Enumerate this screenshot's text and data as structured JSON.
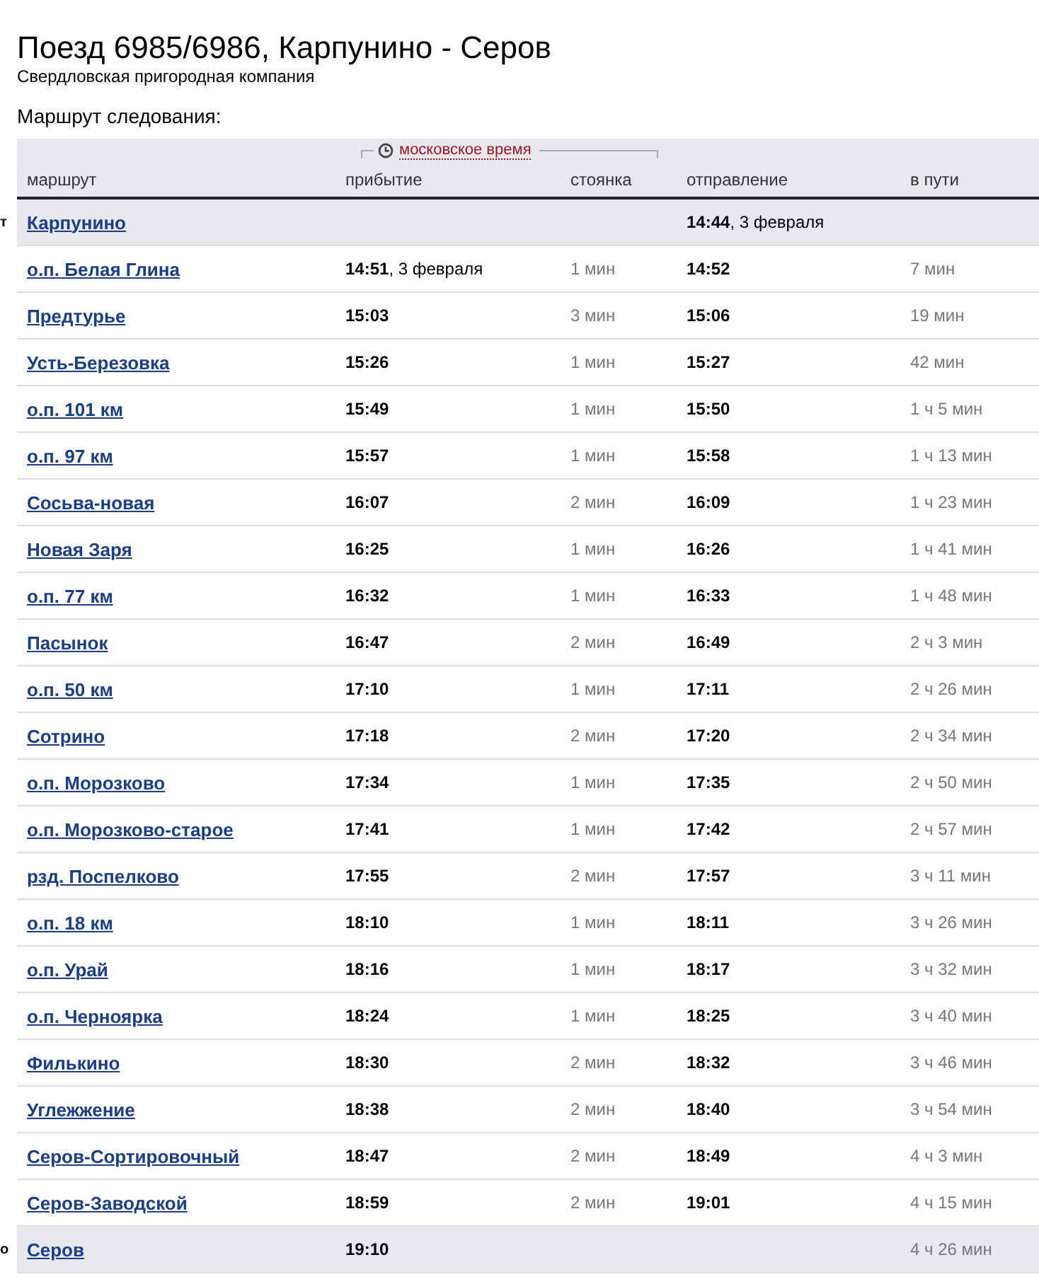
{
  "title": "Поезд 6985/6986, Карпунино - Серов",
  "subtitle": "Свердловская пригородная компания",
  "section_label": "Маршрут следования:",
  "time_zone_label": "московское время",
  "columns": [
    "маршрут",
    "прибытие",
    "стоянка",
    "отправление",
    "в пути"
  ],
  "rows": [
    {
      "kind": "terminal",
      "edge_mark": "т",
      "station": "Карпунино",
      "departure": "**14:44**, 3 февраля"
    },
    {
      "kind": "stop",
      "station": "о.п. Белая Глина",
      "arrival": "**14:51**, 3 февраля",
      "stop": "1 мин",
      "departure": "**14:52**",
      "travel": "7 мин"
    },
    {
      "kind": "stop",
      "station": "Предтурье",
      "arrival": "**15:03**",
      "stop": "3 мин",
      "departure": "**15:06**",
      "travel": "19 мин"
    },
    {
      "kind": "stop",
      "station": "Усть-Березовка",
      "arrival": "**15:26**",
      "stop": "1 мин",
      "departure": "**15:27**",
      "travel": "42 мин"
    },
    {
      "kind": "stop",
      "station": "о.п. 101 км",
      "arrival": "**15:49**",
      "stop": "1 мин",
      "departure": "**15:50**",
      "travel": "1 ч 5 мин"
    },
    {
      "kind": "stop",
      "station": "о.п. 97 км",
      "arrival": "**15:57**",
      "stop": "1 мин",
      "departure": "**15:58**",
      "travel": "1 ч 13 мин"
    },
    {
      "kind": "stop",
      "station": "Сосьва-новая",
      "arrival": "**16:07**",
      "stop": "2 мин",
      "departure": "**16:09**",
      "travel": "1 ч 23 мин"
    },
    {
      "kind": "stop",
      "station": "Новая Заря",
      "arrival": "**16:25**",
      "stop": "1 мин",
      "departure": "**16:26**",
      "travel": "1 ч 41 мин"
    },
    {
      "kind": "stop",
      "station": "о.п. 77 км",
      "arrival": "**16:32**",
      "stop": "1 мин",
      "departure": "**16:33**",
      "travel": "1 ч 48 мин"
    },
    {
      "kind": "stop",
      "station": "Пасынок",
      "arrival": "**16:47**",
      "stop": "2 мин",
      "departure": "**16:49**",
      "travel": "2 ч 3 мин"
    },
    {
      "kind": "stop",
      "station": "о.п. 50 км",
      "arrival": "**17:10**",
      "stop": "1 мин",
      "departure": "**17:11**",
      "travel": "2 ч 26 мин"
    },
    {
      "kind": "stop",
      "station": "Сотрино",
      "arrival": "**17:18**",
      "stop": "2 мин",
      "departure": "**17:20**",
      "travel": "2 ч 34 мин"
    },
    {
      "kind": "stop",
      "station": "о.п. Морозково",
      "arrival": "**17:34**",
      "stop": "1 мин",
      "departure": "**17:35**",
      "travel": "2 ч 50 мин"
    },
    {
      "kind": "stop",
      "station": "о.п. Морозково-старое",
      "arrival": "**17:41**",
      "stop": "1 мин",
      "departure": "**17:42**",
      "travel": "2 ч 57 мин"
    },
    {
      "kind": "stop",
      "station": "рзд. Поспелково",
      "arrival": "**17:55**",
      "stop": "2 мин",
      "departure": "**17:57**",
      "travel": "3 ч 11 мин"
    },
    {
      "kind": "stop",
      "station": "о.п. 18 км",
      "arrival": "**18:10**",
      "stop": "1 мин",
      "departure": "**18:11**",
      "travel": "3 ч 26 мин"
    },
    {
      "kind": "stop",
      "station": "о.п. Урай",
      "arrival": "**18:16**",
      "stop": "1 мин",
      "departure": "**18:17**",
      "travel": "3 ч 32 мин"
    },
    {
      "kind": "stop",
      "station": "о.п. Черноярка",
      "arrival": "**18:24**",
      "stop": "1 мин",
      "departure": "**18:25**",
      "travel": "3 ч 40 мин"
    },
    {
      "kind": "stop",
      "station": "Филькино",
      "arrival": "**18:30**",
      "stop": "2 мин",
      "departure": "**18:32**",
      "travel": "3 ч 46 мин"
    },
    {
      "kind": "stop",
      "station": "Углежжение",
      "arrival": "**18:38**",
      "stop": "2 мин",
      "departure": "**18:40**",
      "travel": "3 ч 54 мин"
    },
    {
      "kind": "stop",
      "station": "Серов-Сортировочный",
      "arrival": "**18:47**",
      "stop": "2 мин",
      "departure": "**18:49**",
      "travel": "4 ч 3 мин"
    },
    {
      "kind": "stop",
      "station": "Серов-Заводской",
      "arrival": "**18:59**",
      "stop": "2 мин",
      "departure": "**19:01**",
      "travel": "4 ч 15 мин"
    },
    {
      "kind": "terminal",
      "edge_mark": "о",
      "station": "Серов",
      "arrival": "**19:10**",
      "travel": "4 ч 26 мин"
    }
  ]
}
